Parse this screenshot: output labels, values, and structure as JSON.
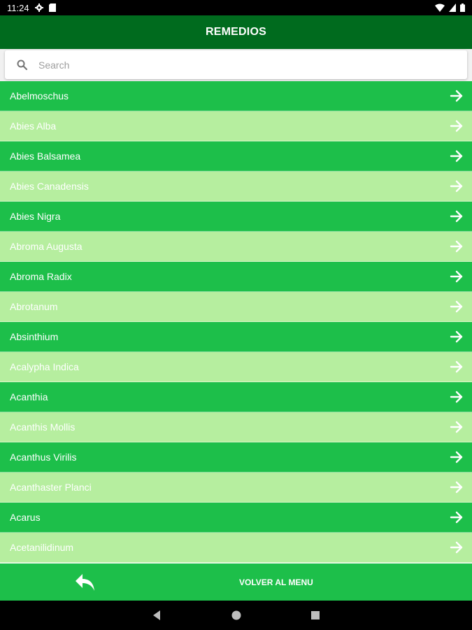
{
  "status_bar": {
    "time": "11:24",
    "icons": [
      "gear-icon",
      "sim-card-icon",
      "wifi-icon",
      "signal-icon",
      "battery-icon"
    ]
  },
  "header": {
    "title": "REMEDIOS"
  },
  "search": {
    "placeholder": "Search",
    "value": "",
    "icon": "search-icon"
  },
  "list": {
    "items": [
      {
        "label": "Abelmoschus"
      },
      {
        "label": "Abies Alba"
      },
      {
        "label": "Abies Balsamea"
      },
      {
        "label": "Abies Canadensis"
      },
      {
        "label": "Abies Nigra"
      },
      {
        "label": "Abroma Augusta"
      },
      {
        "label": "Abroma Radix"
      },
      {
        "label": "Abrotanum"
      },
      {
        "label": "Absinthium"
      },
      {
        "label": "Acalypha Indica"
      },
      {
        "label": "Acanthia"
      },
      {
        "label": "Acanthis Mollis"
      },
      {
        "label": "Acanthus Virilis"
      },
      {
        "label": "Acanthaster Planci"
      },
      {
        "label": "Acarus"
      },
      {
        "label": "Acetanilidinum"
      }
    ],
    "item_icon": "arrow-right-icon"
  },
  "footer": {
    "back_icon": "reply-arrow-icon",
    "menu_label": "VOLVER AL MENU"
  },
  "nav_bar": {
    "icons": [
      "back-triangle-icon",
      "home-circle-icon",
      "recents-square-icon"
    ]
  },
  "colors": {
    "status_bar": "#000000",
    "app_bar": "#006b1e",
    "row_dark": "#1dbf4a",
    "row_light": "#b6ee9f",
    "footer": "#1dbf4a",
    "text": "#ffffff"
  }
}
